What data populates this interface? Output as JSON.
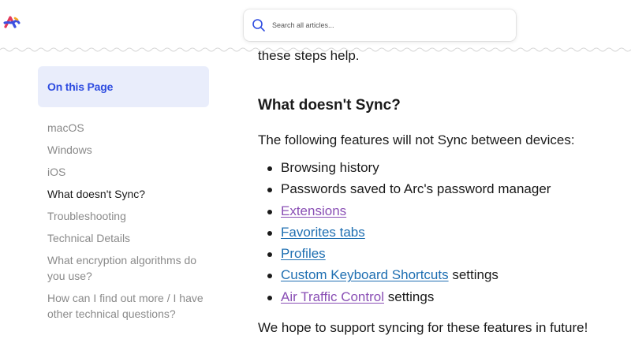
{
  "header": {
    "logo_icon": "arc-logo-icon",
    "search": {
      "placeholder": "Search all articles...",
      "icon": "search-icon"
    }
  },
  "sidebar": {
    "title": "On this Page",
    "items": [
      {
        "label": "macOS",
        "active": false
      },
      {
        "label": "Windows",
        "active": false
      },
      {
        "label": "iOS",
        "active": false
      },
      {
        "label": "What doesn't Sync?",
        "active": true
      },
      {
        "label": "Troubleshooting",
        "active": false
      },
      {
        "label": "Technical Details",
        "active": false
      },
      {
        "label": "What encryption algorithms do you use?",
        "active": false
      },
      {
        "label": "How can I find out more / I have other technical questions?",
        "active": false
      }
    ]
  },
  "content": {
    "intro_fragment": "these steps help.",
    "heading": "What doesn't Sync?",
    "lead": "The following features will not Sync between devices:",
    "features": [
      {
        "text": "Browsing history"
      },
      {
        "text": "Passwords saved to Arc's password manager"
      },
      {
        "link": "Extensions"
      },
      {
        "link": "Favorites tabs"
      },
      {
        "link": "Profiles"
      },
      {
        "link": "Custom Keyboard Shortcuts",
        "suffix": " settings"
      },
      {
        "link": "Air Traffic Control",
        "suffix": " settings"
      }
    ],
    "outro": "We hope to support syncing for these features in future!"
  },
  "colors": {
    "accent": "#2e4ce0",
    "toc_bg": "#e9edfb",
    "link_visited": "#8a4fb5",
    "link": "#1f6fb2",
    "muted_text": "#8a8a8a"
  }
}
